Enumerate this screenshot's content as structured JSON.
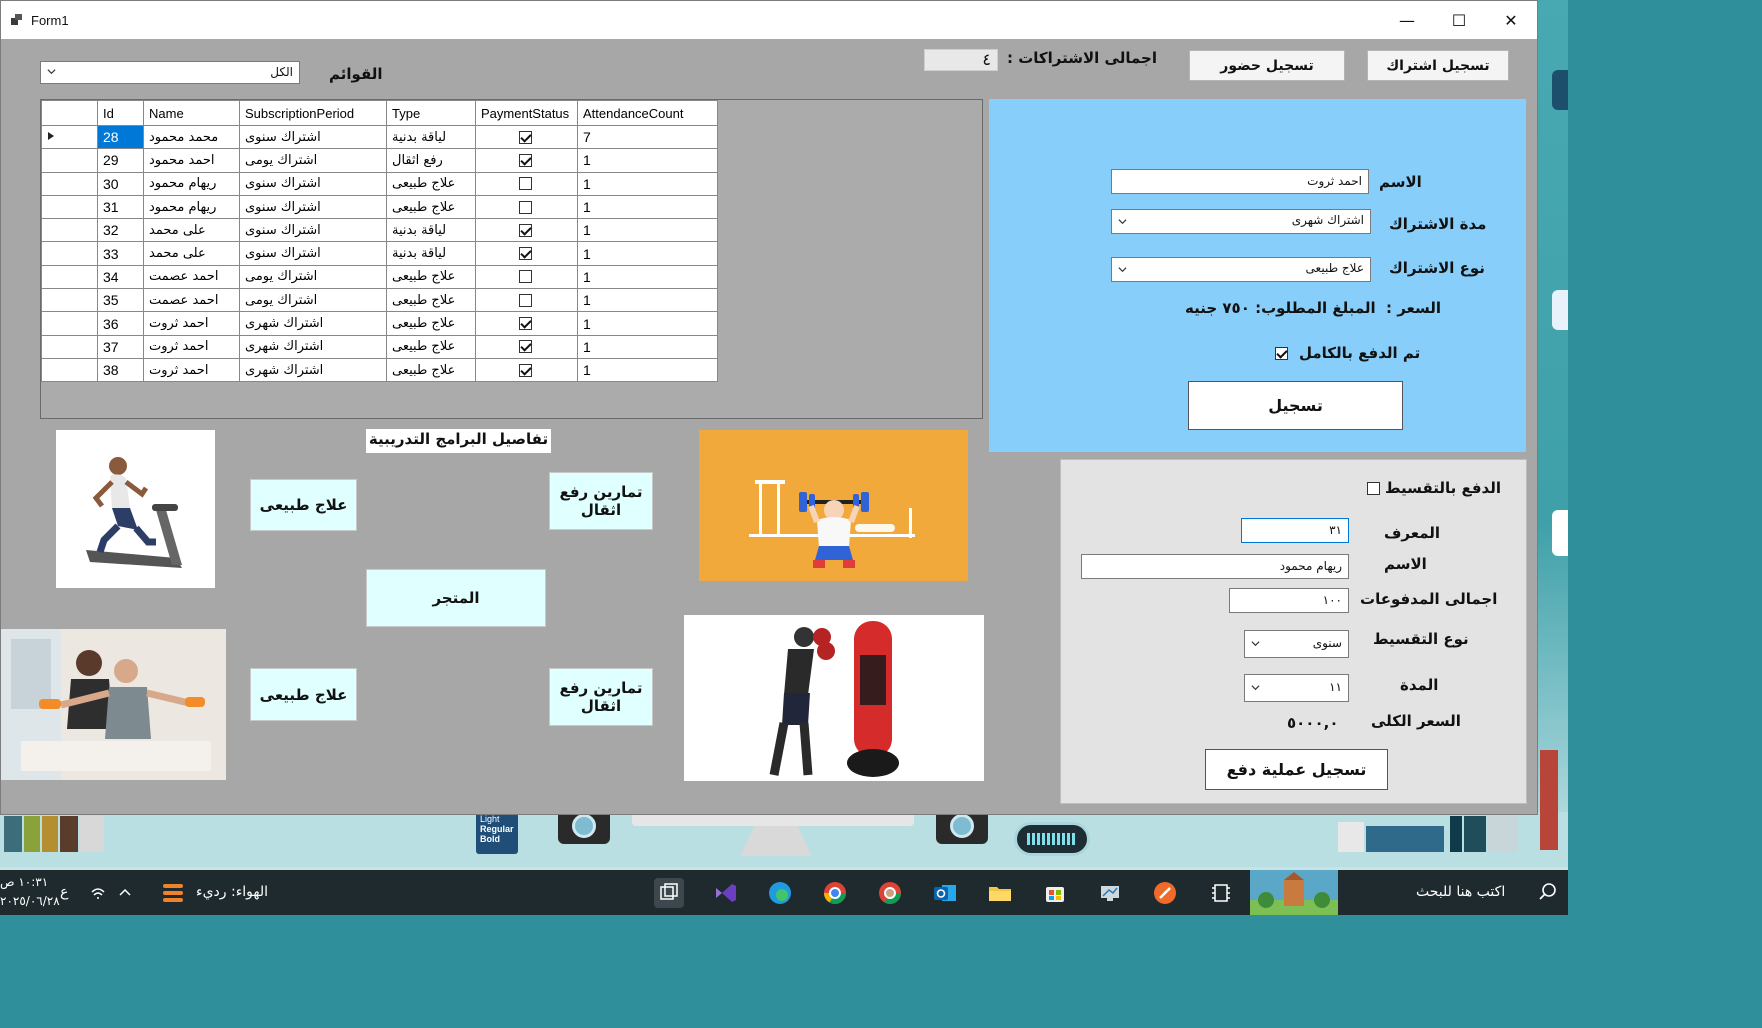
{
  "window": {
    "title": "Form1",
    "minimize": "—",
    "maximize": "☐",
    "close": "✕"
  },
  "top": {
    "lists_label": "القوائم",
    "filter_value": "الكل",
    "total_subs_label": "اجمالى الاشتراكات :",
    "total_subs_value": "٤",
    "attendance_button": "تسجيل حضور",
    "subscribe_button": "تسجيل اشتراك"
  },
  "grid": {
    "columns": [
      "Id",
      "Name",
      "SubscriptionPeriod",
      "Type",
      "PaymentStatus",
      "AttendanceCount"
    ],
    "rows": [
      {
        "id": "28",
        "name": "محمد محمود",
        "period": "اشتراك سنوى",
        "type": "لياقة بدنية",
        "paid": true,
        "count": "7"
      },
      {
        "id": "29",
        "name": "احمد محمود",
        "period": "اشتراك يومى",
        "type": "رفع اثقال",
        "paid": true,
        "count": "1"
      },
      {
        "id": "30",
        "name": "ريهام محمود",
        "period": "اشتراك سنوى",
        "type": "علاج طبيعى",
        "paid": false,
        "count": "1"
      },
      {
        "id": "31",
        "name": "ريهام محمود",
        "period": "اشتراك سنوى",
        "type": "علاج طبيعى",
        "paid": false,
        "count": "1"
      },
      {
        "id": "32",
        "name": "على محمد",
        "period": "اشتراك سنوى",
        "type": "لياقة بدنية",
        "paid": true,
        "count": "1"
      },
      {
        "id": "33",
        "name": "على محمد",
        "period": "اشتراك سنوى",
        "type": "لياقة بدنية",
        "paid": true,
        "count": "1"
      },
      {
        "id": "34",
        "name": "احمد عصمت",
        "period": "اشتراك يومى",
        "type": "علاج طبيعى",
        "paid": false,
        "count": "1"
      },
      {
        "id": "35",
        "name": "احمد عصمت",
        "period": "اشتراك يومى",
        "type": "علاج طبيعى",
        "paid": false,
        "count": "1"
      },
      {
        "id": "36",
        "name": "احمد ثروت",
        "period": "اشتراك شهرى",
        "type": "علاج طبيعى",
        "paid": true,
        "count": "1"
      },
      {
        "id": "37",
        "name": "احمد ثروت",
        "period": "اشتراك شهرى",
        "type": "علاج طبيعى",
        "paid": true,
        "count": "1"
      },
      {
        "id": "38",
        "name": "احمد ثروت",
        "period": "اشتراك شهرى",
        "type": "علاج طبيعى",
        "paid": true,
        "count": "1"
      }
    ]
  },
  "register": {
    "name_label": "الاسم",
    "name_value": "احمد ثروت",
    "period_label": "مدة الاشتراك",
    "period_value": "اشتراك شهرى",
    "type_label": "نوع الاشتراك",
    "type_value": "علاج طبيعى",
    "price_label": "السعر :",
    "price_value": "المبلغ المطلوب: ٧٥٠ جنيه",
    "full_paid_label": "تم الدفع بالكامل",
    "full_paid_checked": true,
    "submit_button": "تسجيل"
  },
  "installment": {
    "toggle_label": "الدفع بالتقسيط",
    "toggle_checked": false,
    "id_label": "المعرف",
    "id_value": "٣١",
    "name_label": "الاسم",
    "name_value": "ريهام محمود",
    "total_paid_label": "اجمالى المدفوعات",
    "total_paid_value": "١٠٠",
    "type_label": "نوع التقسيط",
    "type_value": "سنوى",
    "duration_label": "المدة",
    "duration_value": "١١",
    "total_price_label": "السعر الكلى",
    "total_price_value": "٥٠٠٠,٠",
    "submit_button": "تسجيل عملية دفع"
  },
  "programs": {
    "title": "تفاصيل البرامج التدريبية",
    "physio_1": "علاج طبيعى",
    "weights_1": "تمارين رفع اثقال",
    "store": "المتجر",
    "physio_2": "علاج طبيعى",
    "weights_2": "تمارين رفع اثقال"
  },
  "taskbar": {
    "search_placeholder": "اكتب هنا للبحث",
    "weather": "الهواء: رديء",
    "time": "١٠:٣١ ص",
    "date": "٢٠٢٥/٠٦/٢٨",
    "lang": "ع"
  },
  "desktop": {
    "font_book_lines": [
      "Light",
      "Regular",
      "Bold"
    ]
  },
  "colors": {
    "accent_blue_panel": "#87cefa",
    "program_button": "#e0ffff",
    "selection": "#0078d7",
    "form_bg": "#a7a7a7"
  }
}
